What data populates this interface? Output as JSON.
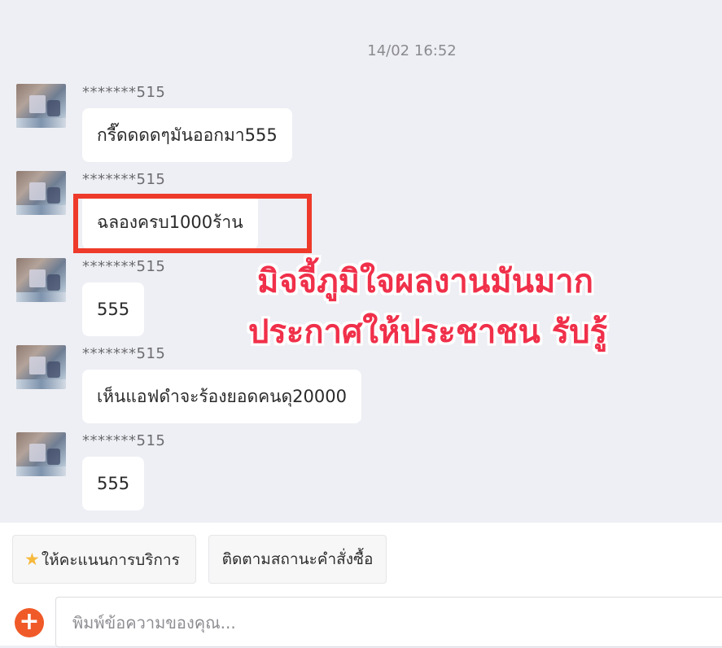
{
  "chat": {
    "timestamp": "14/02 16:52",
    "messages": [
      {
        "sender": "*******515",
        "text": "กรี๊ดดดดๆมันออกมา555"
      },
      {
        "sender": "*******515",
        "text": "ฉลองครบ1000ร้าน"
      },
      {
        "sender": "*******515",
        "text": "555"
      },
      {
        "sender": "*******515",
        "text": "เห็นแอฟดำจะร้องยอดคนดุ20000"
      },
      {
        "sender": "*******515",
        "text": "555"
      }
    ]
  },
  "overlay": {
    "line1": "มิจจี้ภูมิใจผลงานมันมาก",
    "line2": "ประกาศให้ประชาชน รับรู้",
    "color": "#f0304a",
    "box_color": "#ee3a2a"
  },
  "quick_actions": {
    "rate_label": "ให้คะแนนการบริการ",
    "rate_icon": "star-icon",
    "track_label": "ติดตามสถานะคำสั่งซื้อ"
  },
  "composer": {
    "placeholder": "พิมพ์ข้อความของคุณ...",
    "add_icon": "plus-icon",
    "accent": "#f05a28"
  }
}
